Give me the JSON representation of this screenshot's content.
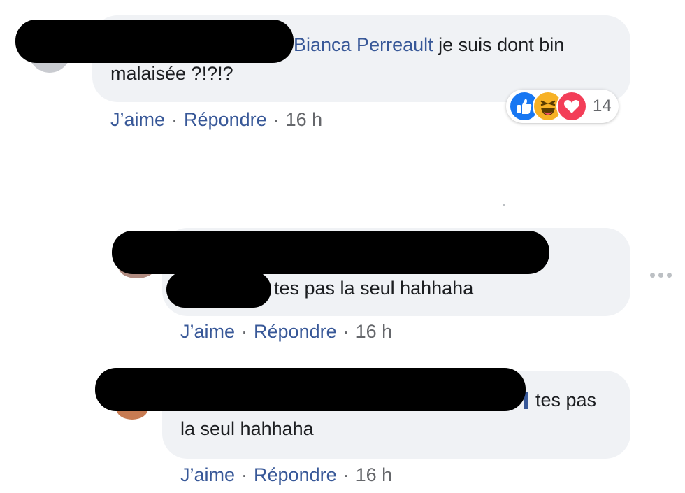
{
  "comments": [
    {
      "mention": "Bianca Perreault",
      "text_line1": " je suis dont bin",
      "text_line2": "malaisée ?!?!?",
      "like": "J’aime",
      "reply": "Répondre",
      "time": "16 h",
      "reaction_count": "14",
      "reaction_icons": [
        "like-icon",
        "haha-icon",
        "love-icon"
      ]
    },
    {
      "text": "tes pas la seul hahhaha",
      "like": "J’aime",
      "reply": "Répondre",
      "time": "16 h"
    },
    {
      "text_line1": "tes pas",
      "text_line2": "la seul hahhaha",
      "like": "J’aime",
      "reply": "Répondre",
      "time": "16 h"
    }
  ],
  "separator": "·",
  "colors": {
    "bubble": "#f0f2f5",
    "link": "#385898",
    "meta": "#65676b",
    "like": "#1877f2",
    "haha": "#f7b125",
    "love": "#f33e58"
  }
}
